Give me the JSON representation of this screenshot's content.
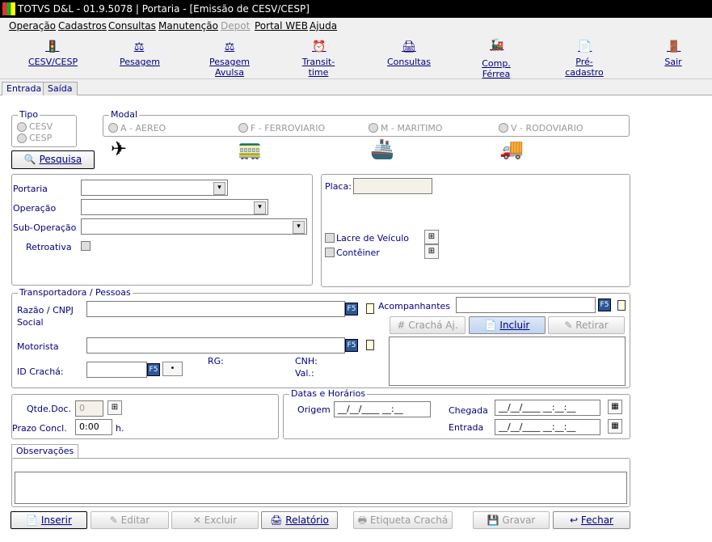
{
  "title": "TOTVS D&L - 01.9.5078 | Portaria - [Emissão de CESV/CESP]",
  "menu": [
    "Operação",
    "Cadastros",
    "Consultas",
    "Manutenção",
    "Depot",
    "Portal WEB",
    "Ajuda"
  ],
  "toolbar": [
    "CESV/CESP",
    "Pesagem",
    "Pesagem Avulsa",
    "Transit-time",
    "Consultas",
    "Comp. Férrea",
    "Pré-cadastro",
    "Sair"
  ],
  "tabs": [
    "Entrada",
    "Saída"
  ],
  "tipo": {
    "title": "Tipo",
    "opt1": "CESV",
    "opt2": "CESP"
  },
  "modal": {
    "title": "Modal",
    "aereo": "A - AEREO",
    "ferro": "F - FERROVIARIO",
    "maritimo": "M - MARITIMO",
    "rodo": "V - RODOVIARIO"
  },
  "pesquisa": "Pesquisa",
  "form": {
    "portaria": "Portaria",
    "operacao": "Operação",
    "sub_operacao": "Sub-Operação",
    "retroativa": "Retroativa"
  },
  "placa": {
    "label": "Placa:",
    "lacre": "Lacre de Veículo",
    "conteiner": "Contêiner"
  },
  "transp": {
    "title": "Transportadora / Pessoas",
    "razao": "Razão / CNPJ",
    "social": "Social",
    "motorista": "Motorista",
    "cracha": "ID Crachá:",
    "rg": "RG:",
    "cnh": "CNH:",
    "val": "Val.:",
    "acomp": "Acompanhantes",
    "cracha_aj": "Crachá Aj.",
    "incluir": "Incluir",
    "retirar": "Retirar",
    "f5": "F5"
  },
  "qtde": {
    "label": "Qtde.Doc.",
    "value": "0",
    "prazo": "Prazo Concl.",
    "prazo_val": "0:00",
    "unit": "h."
  },
  "datas": {
    "title": "Datas e Horários",
    "origem": "Origem",
    "origem_val": "__/__/____ __:__",
    "chegada": "Chegada",
    "chegada_val": "__/__/____ __:__:__",
    "entrada": "Entrada",
    "entrada_val": "__/__/____ __:__:__"
  },
  "obs": "Observações",
  "buttons": {
    "inserir": "Inserir",
    "editar": "Editar",
    "excluir": "Excluir",
    "relatorio": "Relatório",
    "etiqueta": "Etiqueta Crachá",
    "gravar": "Gravar",
    "fechar": "Fechar"
  }
}
